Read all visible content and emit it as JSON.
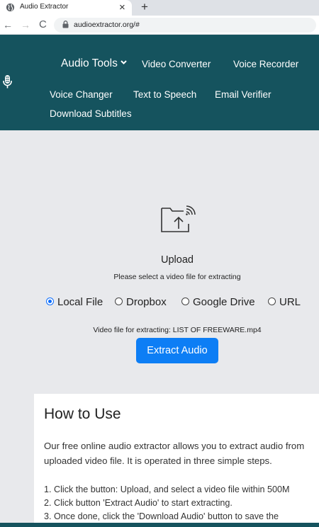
{
  "browser": {
    "tab_title": "Audio Extractor",
    "tab_close": "×",
    "new_tab": "+",
    "url": "audioextractor.org/#",
    "back": "←",
    "forward": "→",
    "reload": "C"
  },
  "nav": {
    "audio_tools": "Audio Tools",
    "video_converter": "Video Converter",
    "voice_recorder": "Voice Recorder",
    "voice_changer": "Voice Changer",
    "text_to_speech": "Text to Speech",
    "email_verifier": "Email Verifier",
    "download_subtitles": "Download Subtitles"
  },
  "upload": {
    "title": "Upload",
    "subtitle": "Please select a video file for extracting",
    "options": [
      "Local File",
      "Dropbox",
      "Google Drive",
      "URL"
    ],
    "selected": "Local File",
    "file_line": "Video file for extracting: LIST OF FREEWARE.mp4",
    "button": "Extract Audio"
  },
  "howto": {
    "title": "How to Use",
    "paragraph": "Our free online audio extractor allows you to extract audio from uploaded video file. It is operated in three simple steps.",
    "steps": [
      "1. Click the button: Upload, and select a video file within 500M",
      "2. Click button 'Extract Audio' to start extracting.",
      "3. Once done, click the 'Download Audio' button to save the"
    ]
  },
  "colors": {
    "header_bg": "#15535e",
    "accent": "#0d7ef5",
    "page_bg": "#e8e9ec"
  },
  "icons": [
    "globe-icon",
    "lock-icon",
    "microphone-icon",
    "chevron-down-icon",
    "upload-file-icon"
  ]
}
